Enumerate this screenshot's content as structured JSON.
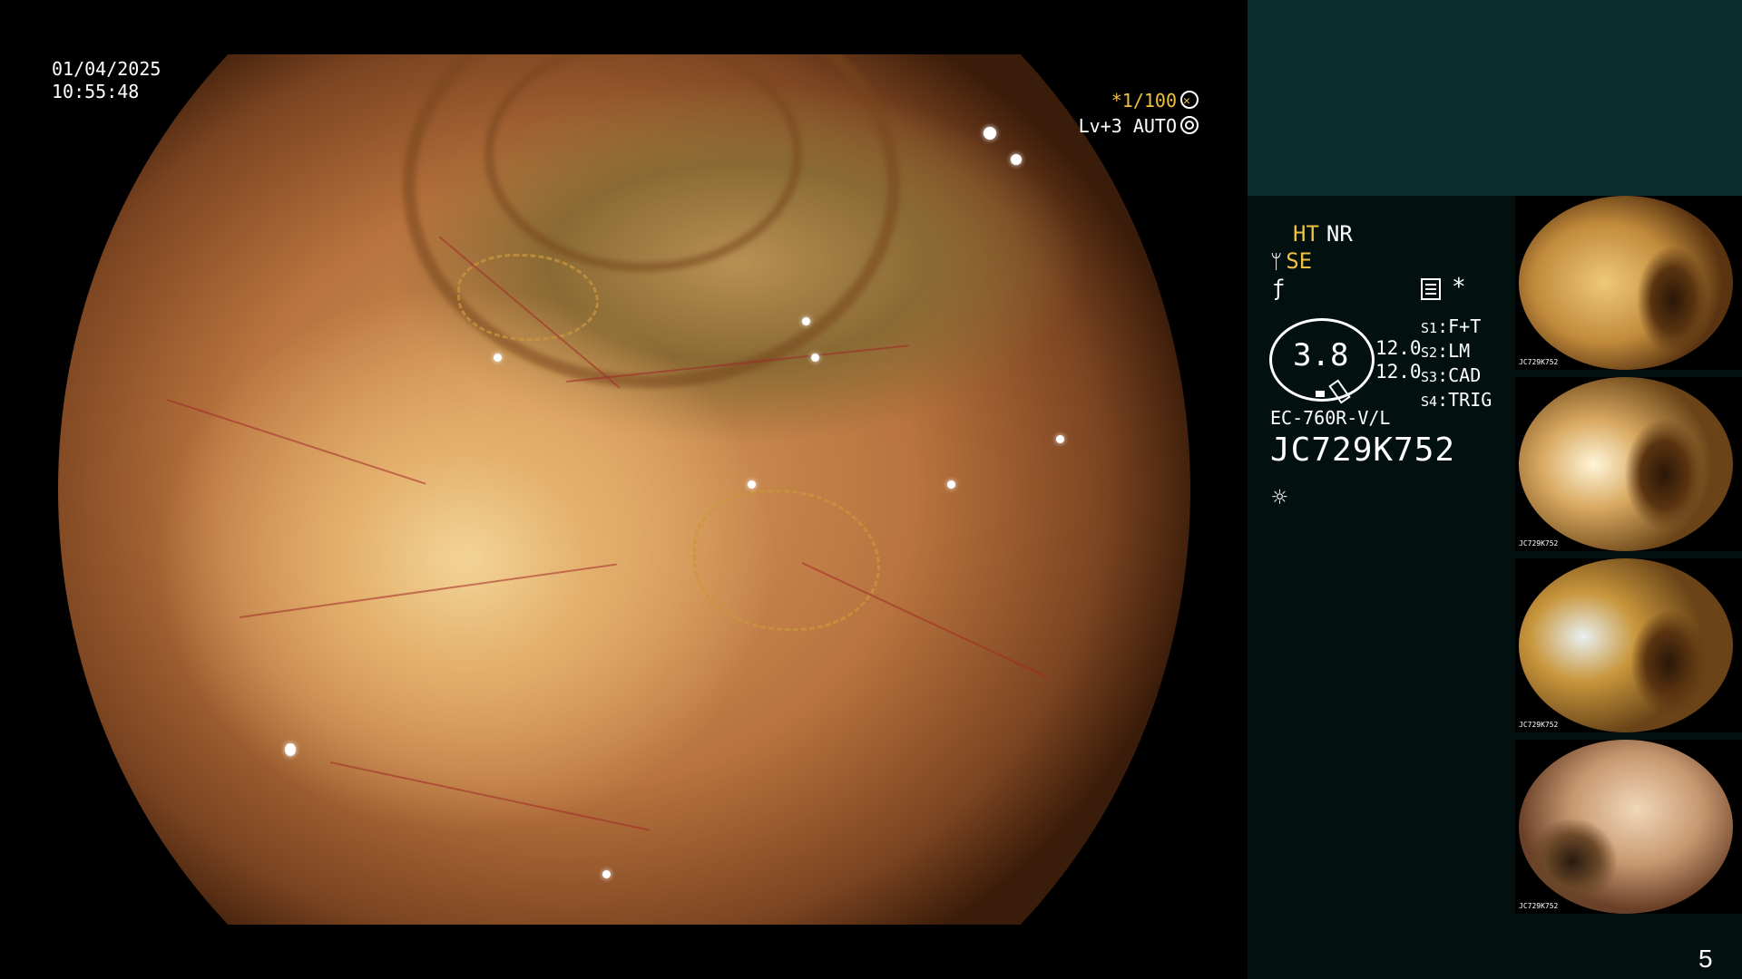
{
  "overlay": {
    "date": "01/04/2025",
    "time": "10:55:48",
    "shutter": "*1/100",
    "level": "Lv+3 AUTO"
  },
  "panel": {
    "ht": "HT",
    "nr": "NR",
    "se": "SE",
    "gauge_value": "3.8",
    "gauge_right_1": "12.0",
    "gauge_right_2": "12.0",
    "switches": [
      {
        "key": "S1",
        "value": "F+T"
      },
      {
        "key": "S2",
        "value": "LM"
      },
      {
        "key": "S3",
        "value": "CAD"
      },
      {
        "key": "S4",
        "value": "TRIG"
      }
    ],
    "scope_model": "EC-760R-V/L",
    "serial": "JC729K752"
  },
  "thumbnails": [
    {
      "label": "JC729K752"
    },
    {
      "label": "JC729K752"
    },
    {
      "label": "JC729K752"
    },
    {
      "label": "JC729K752"
    }
  ],
  "page_number": "5",
  "icons": {
    "fan": "fan-icon",
    "gear": "gear-icon",
    "panel": "panel-icon",
    "sun": "sun-icon"
  }
}
